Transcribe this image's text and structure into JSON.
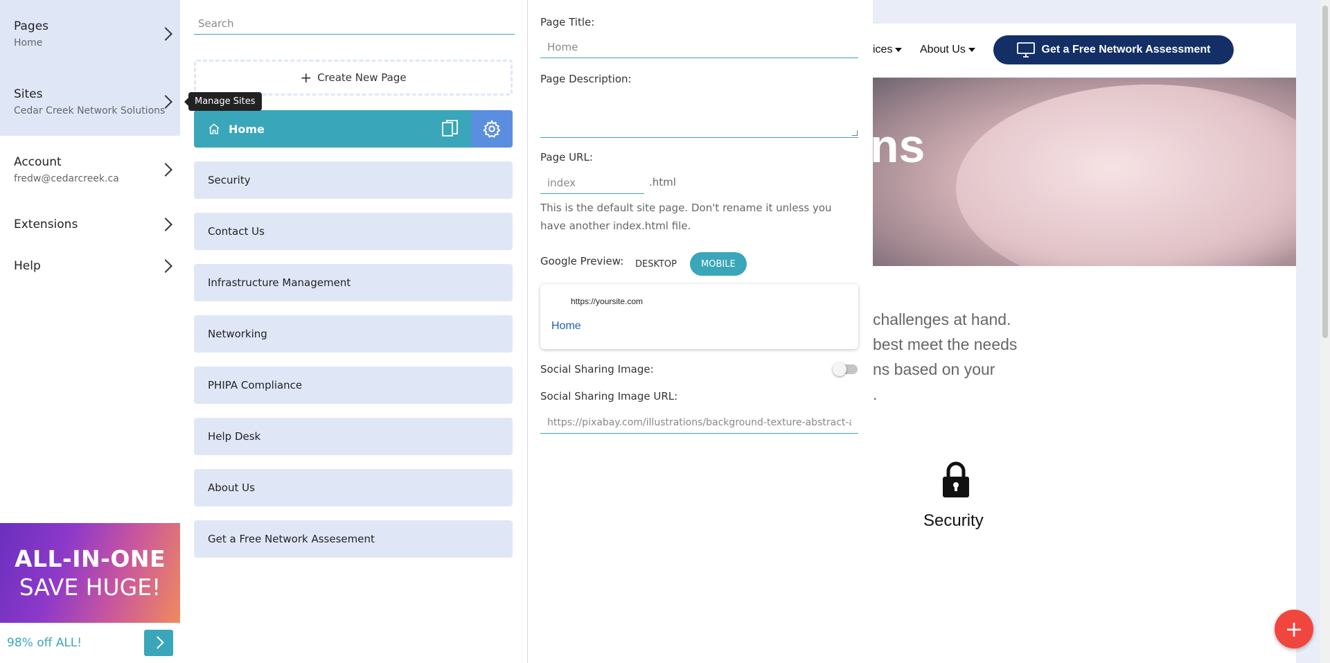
{
  "left_nav": {
    "items": [
      {
        "title": "Pages",
        "subtitle": "Home"
      },
      {
        "title": "Sites",
        "subtitle": "Cedar Creek Network Solutions"
      },
      {
        "title": "Account",
        "subtitle": "fredw@cedarcreek.ca"
      },
      {
        "title": "Extensions"
      },
      {
        "title": "Help"
      }
    ],
    "tooltip": "Manage Sites"
  },
  "promo": {
    "line1": "ALL-IN-ONE",
    "line2": "SAVE HUGE!",
    "offer": "98% off ALL!"
  },
  "pages_panel": {
    "search_placeholder": "Search",
    "create_label": "Create New Page",
    "active_page": "Home",
    "pages": [
      "Security",
      "Contact Us",
      "Infrastructure Management",
      "Networking",
      "PHIPA Compliance",
      "Help Desk",
      "About Us",
      "Get a Free Network Assesement"
    ]
  },
  "settings": {
    "title_label": "Page Title:",
    "title_placeholder": "Home",
    "desc_label": "Page Description:",
    "url_label": "Page URL:",
    "url_placeholder": "index",
    "url_suffix": ".html",
    "url_help": "This is the default site page. Don't rename it unless you have another index.html file.",
    "preview_label": "Google Preview:",
    "tab_desktop": "DESKTOP",
    "tab_mobile": "MOBILE",
    "preview_url": "https://yoursite.com",
    "preview_title": "Home",
    "social_image_label": "Social Sharing Image:",
    "social_image_enabled": false,
    "social_url_label": "Social Sharing Image URL:",
    "social_url_placeholder": "https://pixabay.com/illustrations/background-texture-abstract-art-("
  },
  "site": {
    "nav_services": "ices",
    "nav_about": "About Us",
    "cta": "Get a Free Network Assessment",
    "hero_fragment": "ns",
    "body_lines": [
      "challenges at hand.",
      "best meet the needs",
      "ns based on your",
      "."
    ],
    "feature_label": "Security"
  },
  "colors": {
    "accent": "#3aa6b9",
    "nav_shade": "#dfe7f7",
    "gear_blue": "#5c8ee0",
    "cta_navy": "#132f66",
    "fab_red": "#f1463e"
  }
}
